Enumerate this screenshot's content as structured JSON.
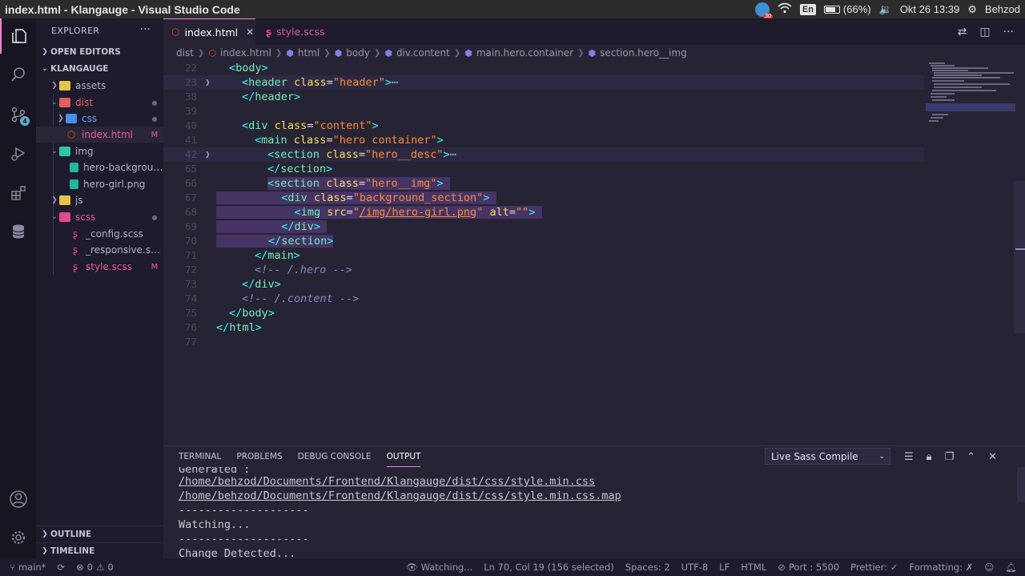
{
  "window": {
    "title": "index.html - Klangauge - Visual Studio Code"
  },
  "tray": {
    "badge_count": "30",
    "lang": "En",
    "battery": "(66%)",
    "datetime": "Okt 26 13:39",
    "user": "Behzod"
  },
  "activity": {
    "source_control_count": "4"
  },
  "sidebar": {
    "title": "EXPLORER",
    "open_editors": "OPEN EDITORS",
    "root": "KLANGAUGE",
    "tree": [
      {
        "name": "assets",
        "status": ""
      },
      {
        "name": "dist",
        "status": ""
      },
      {
        "name": "css",
        "status": ""
      },
      {
        "name": "index.html",
        "status": "M"
      },
      {
        "name": "img",
        "status": ""
      },
      {
        "name": "hero-background.png",
        "status": ""
      },
      {
        "name": "hero-girl.png",
        "status": ""
      },
      {
        "name": "js",
        "status": ""
      },
      {
        "name": "scss",
        "status": ""
      },
      {
        "name": "_config.scss",
        "status": ""
      },
      {
        "name": "_responsive.scss",
        "status": ""
      },
      {
        "name": "style.scss",
        "status": "M"
      }
    ],
    "outline": "OUTLINE",
    "timeline": "TIMELINE"
  },
  "tabs": [
    {
      "label": "index.html",
      "active": true
    },
    {
      "label": "style.scss",
      "active": false
    }
  ],
  "breadcrumb": [
    "dist",
    "index.html",
    "html",
    "body",
    "div.content",
    "main.hero.container",
    "section.hero__img"
  ],
  "line_numbers": [
    "22",
    "23",
    "38",
    "39",
    "40",
    "41",
    "42",
    "65",
    "66",
    "67",
    "68",
    "69",
    "70",
    "71",
    "72",
    "73",
    "74",
    "75",
    "76",
    "77"
  ],
  "code": {
    "l22": {
      "tag": "body"
    },
    "l23": {
      "tag": "header",
      "attr": "class",
      "val": "\"header\"",
      "ell": "⋯"
    },
    "l38": {
      "tag": "header"
    },
    "l40": {
      "tag": "div",
      "attr": "class",
      "val": "\"content\""
    },
    "l41": {
      "tag": "main",
      "attr": "class",
      "val": "\"hero container\""
    },
    "l42": {
      "tag": "section",
      "attr": "class",
      "val": "\"hero__desc\"",
      "ell": "⋯"
    },
    "l65": {
      "tag": "section"
    },
    "l66": {
      "tag": "section",
      "attr": "class",
      "val": "\"hero__img\""
    },
    "l67": {
      "tag": "div",
      "attr": "class",
      "val": "\"background_section\""
    },
    "l68": {
      "tag": "img",
      "attr": "src",
      "val_q": "\"",
      "val_path": "/img/hero-girl.png",
      "attr2": "alt",
      "val2": "\"\""
    },
    "l69": {
      "tag": "div"
    },
    "l70": {
      "tag": "section"
    },
    "l71": {
      "tag": "main"
    },
    "l72": {
      "comment": "<!-- /.hero -->"
    },
    "l73": {
      "tag": "div"
    },
    "l74": {
      "comment": "<!-- /.content -->"
    },
    "l75": {
      "tag": "body"
    },
    "l76": {
      "tag": "html"
    }
  },
  "panel": {
    "tabs": [
      "TERMINAL",
      "PROBLEMS",
      "DEBUG CONSOLE",
      "OUTPUT"
    ],
    "active_tab": "OUTPUT",
    "selected_channel": "Live Sass Compile",
    "lines": [
      "Generated :",
      "/home/behzod/Documents/Frontend/Klangauge/dist/css/style.min.css",
      "/home/behzod/Documents/Frontend/Klangauge/dist/css/style.min.css.map",
      "--------------------",
      "Watching...",
      "--------------------",
      "Change Detected..."
    ]
  },
  "status": {
    "branch": "main*",
    "errors": "0",
    "warnings": "0",
    "watching": "Watching...",
    "position": "Ln 70, Col 19 (156 selected)",
    "spaces": "Spaces: 2",
    "encoding": "UTF-8",
    "eol": "LF",
    "language": "HTML",
    "port": "Port : 5500",
    "prettier": "Prettier: ✓",
    "formatting": "Formatting: ✗"
  },
  "colors": {
    "accent": "#ff7edb",
    "tag": "#72f1b8",
    "attr": "#fede5d",
    "string": "#ff8b39",
    "comment": "#848bbd",
    "editor_bg": "#262335"
  }
}
